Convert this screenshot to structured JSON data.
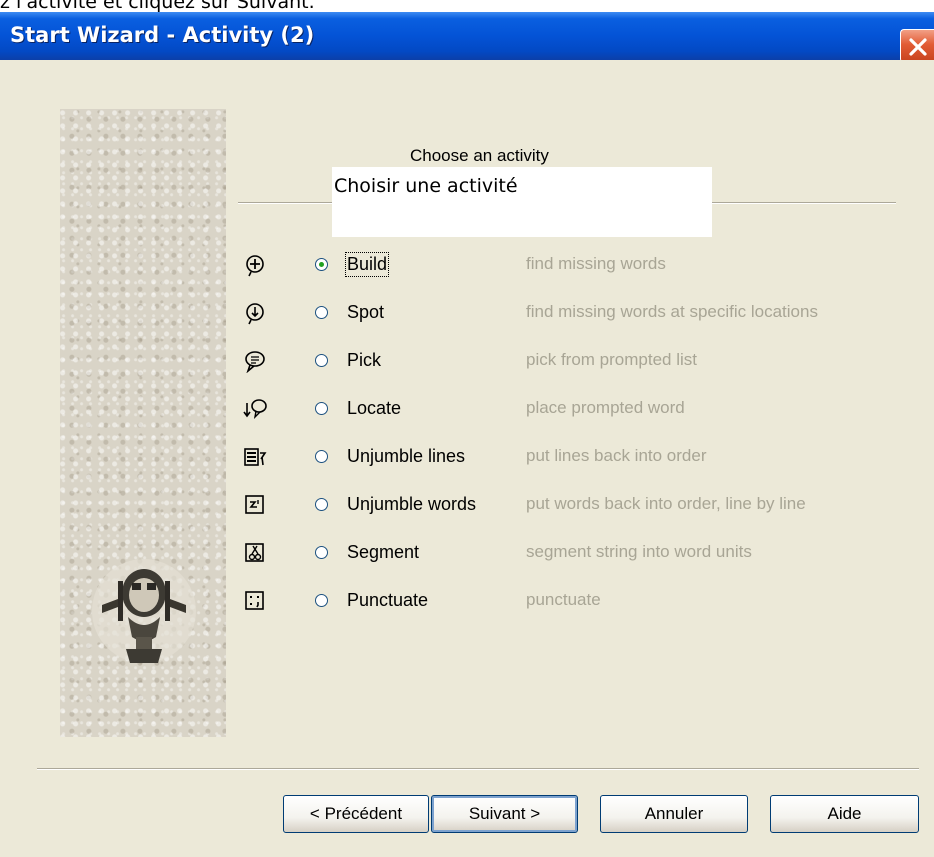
{
  "top_caption": "z l'activité et cliquez sur Suivant.",
  "window": {
    "title": "Start Wizard - Activity (2)"
  },
  "heading": "Choose an activity",
  "overlay_text": "Choisir une activité",
  "activities": [
    {
      "icon": "build-icon",
      "label": "Build",
      "description": "find missing words",
      "selected": true
    },
    {
      "icon": "spot-icon",
      "label": "Spot",
      "description": "find missing words at specific locations",
      "selected": false
    },
    {
      "icon": "pick-icon",
      "label": "Pick",
      "description": "pick from prompted list",
      "selected": false
    },
    {
      "icon": "locate-icon",
      "label": "Locate",
      "description": "place prompted word",
      "selected": false
    },
    {
      "icon": "unjumble-lines-icon",
      "label": "Unjumble lines",
      "description": "put lines back into order",
      "selected": false
    },
    {
      "icon": "unjumble-words-icon",
      "label": "Unjumble words",
      "description": "put words back into order, line by line",
      "selected": false
    },
    {
      "icon": "segment-icon",
      "label": "Segment",
      "description": "segment string into word units",
      "selected": false
    },
    {
      "icon": "punctuate-icon",
      "label": "Punctuate",
      "description": "punctuate",
      "selected": false
    }
  ],
  "buttons": {
    "previous": "< Précédent",
    "next": "Suivant >",
    "cancel": "Annuler",
    "help": "Aide"
  },
  "colors": {
    "titlebar": "#0453d6",
    "close_button": "#e25c35",
    "dialog_background": "#ece9d8",
    "description_text": "#a8a595",
    "radio_dot": "#21a121"
  }
}
